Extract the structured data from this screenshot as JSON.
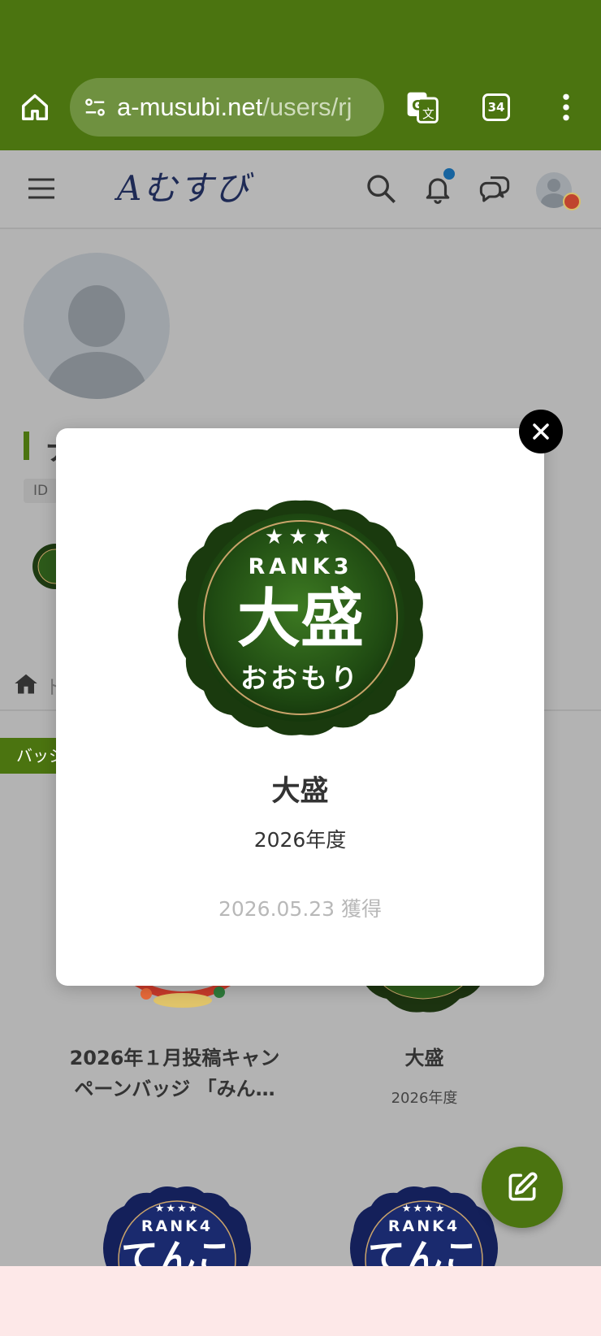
{
  "browser": {
    "url_host": "a-musubi.net",
    "url_path": "/users/rj",
    "tab_count": "34"
  },
  "site": {
    "logo_text": "Aむすび"
  },
  "profile": {
    "name_visible": "ナ",
    "id_label": "ID",
    "breadcrumb_visible": "ト",
    "tab_label": "バッジ"
  },
  "cards": [
    {
      "title": "2026年１月投稿キャンペーンバッジ 「みん…",
      "subtitle": ""
    },
    {
      "title": "大盛",
      "subtitle": "2026年度"
    }
  ],
  "rank4_badges": [
    {
      "rank_text": "RANK4",
      "name_text": "てんこ"
    },
    {
      "rank_text": "RANK4",
      "name_text": "てんこ"
    }
  ],
  "modal": {
    "badge": {
      "stars": "★★★",
      "rank_text": "RANK3",
      "main_text": "大盛",
      "reading_text": "おおもり"
    },
    "title": "大盛",
    "year": "2026年度",
    "acquired": "2026.05.23 獲得"
  },
  "colors": {
    "chrome_green": "#4b7410",
    "badge_green": "#2d5a1a",
    "rank4_navy": "#1a2a6e",
    "notification_dot": "#17649f"
  }
}
